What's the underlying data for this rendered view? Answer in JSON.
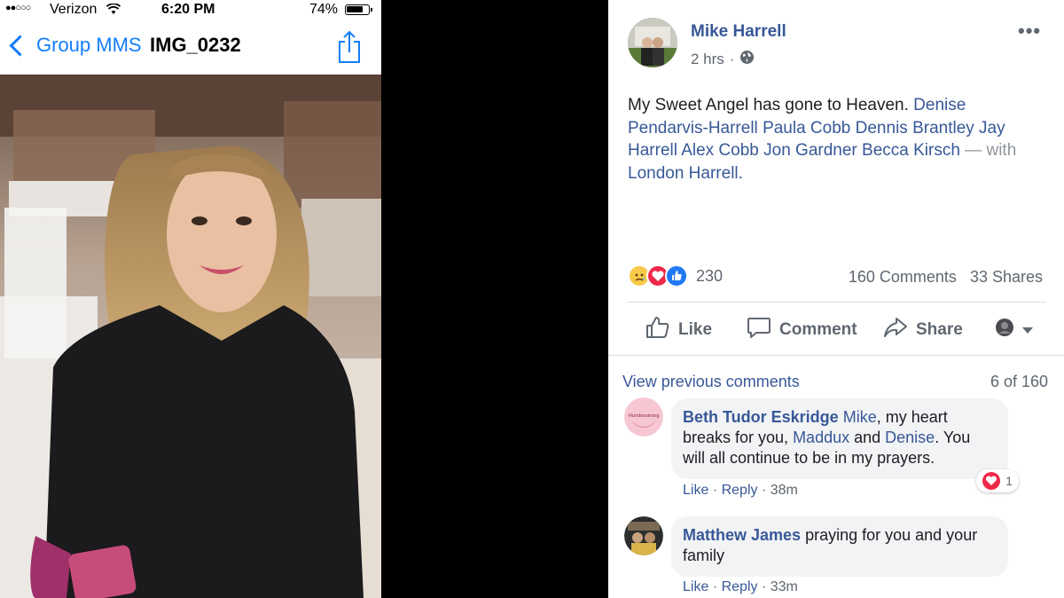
{
  "phone": {
    "status": {
      "carrier": "Verizon",
      "time": "6:20 PM",
      "battery_pct": "74%"
    },
    "nav": {
      "back_label": "Group MMS",
      "title": "IMG_0232"
    }
  },
  "post": {
    "author": "Mike Harrell",
    "time": "2 hrs",
    "text": "My Sweet Angel has gone to Heaven.",
    "tags": [
      "Denise Pendarvis-Harrell",
      "Paula Cobb",
      "Dennis Brantley",
      "Jay Harrell",
      "Alex Cobb",
      "Jon Gardner",
      "Becca Kirsch"
    ],
    "with_label": "— with",
    "with_person": "London Harrell.",
    "reaction_count": "230",
    "comments_count": "160 Comments",
    "shares_count": "33 Shares",
    "actions": {
      "like": "Like",
      "comment": "Comment",
      "share": "Share"
    }
  },
  "comments_section": {
    "view_previous": "View previous comments",
    "pager": "6 of 160",
    "comments": [
      {
        "name": "Beth Tudor Eskridge",
        "parts": [
          "Mike",
          ", my heart breaks for you, ",
          "Maddux",
          " and ",
          "Denise",
          ". You will all continue to be in my prayers."
        ],
        "avatar_text": "#lundonstrong",
        "reaction_count": "1",
        "like": "Like",
        "reply": "Reply",
        "time": "38m"
      },
      {
        "name": "Matthew James",
        "text": "praying for you and your family",
        "like": "Like",
        "reply": "Reply",
        "time": "33m"
      }
    ]
  },
  "colors": {
    "link": "#385898",
    "ios_blue": "#157efb",
    "muted": "#606770",
    "bubble": "#f2f3f5"
  }
}
